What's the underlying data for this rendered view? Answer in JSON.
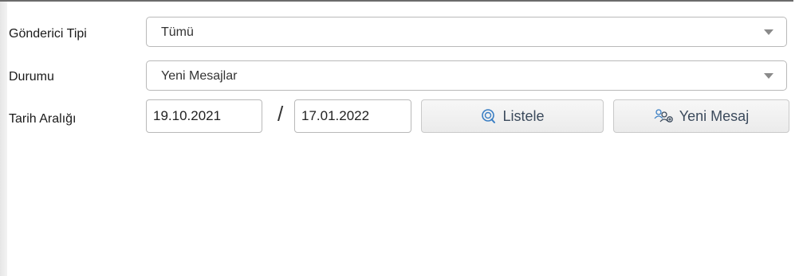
{
  "form": {
    "sender_type": {
      "label": "Gönderici Tipi",
      "value": "Tümü"
    },
    "status": {
      "label": "Durumu",
      "value": "Yeni Mesajlar"
    },
    "date_range": {
      "label": "Tarih Aralığı",
      "start": "19.10.2021",
      "separator": "/",
      "end": "17.01.2022"
    }
  },
  "buttons": {
    "list_label": "Listele",
    "list_icon": "search-icon",
    "new_message_label": "Yeni Mesaj",
    "new_message_icon": "users-add-icon"
  },
  "colors": {
    "button_text": "#3b4a5c",
    "icon_blue": "#3b7fc4"
  }
}
